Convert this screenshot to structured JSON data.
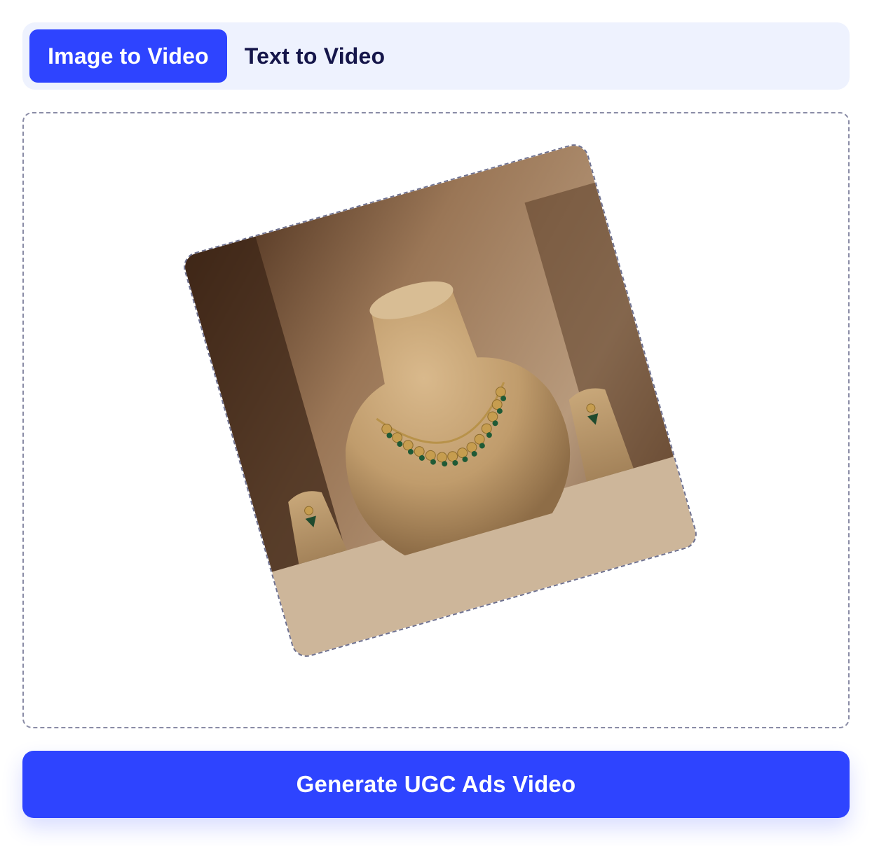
{
  "tabs": [
    {
      "label": "Image to Video",
      "active": true
    },
    {
      "label": "Text to Video",
      "active": false
    }
  ],
  "upload": {
    "image_subject": "necklace-and-earrings-on-display-bust"
  },
  "actions": {
    "generate_label": "Generate UGC Ads Video"
  },
  "colors": {
    "accent": "#2e44ff",
    "tab_bar_bg": "#eef2fe",
    "tab_inactive_text": "#15164a"
  }
}
